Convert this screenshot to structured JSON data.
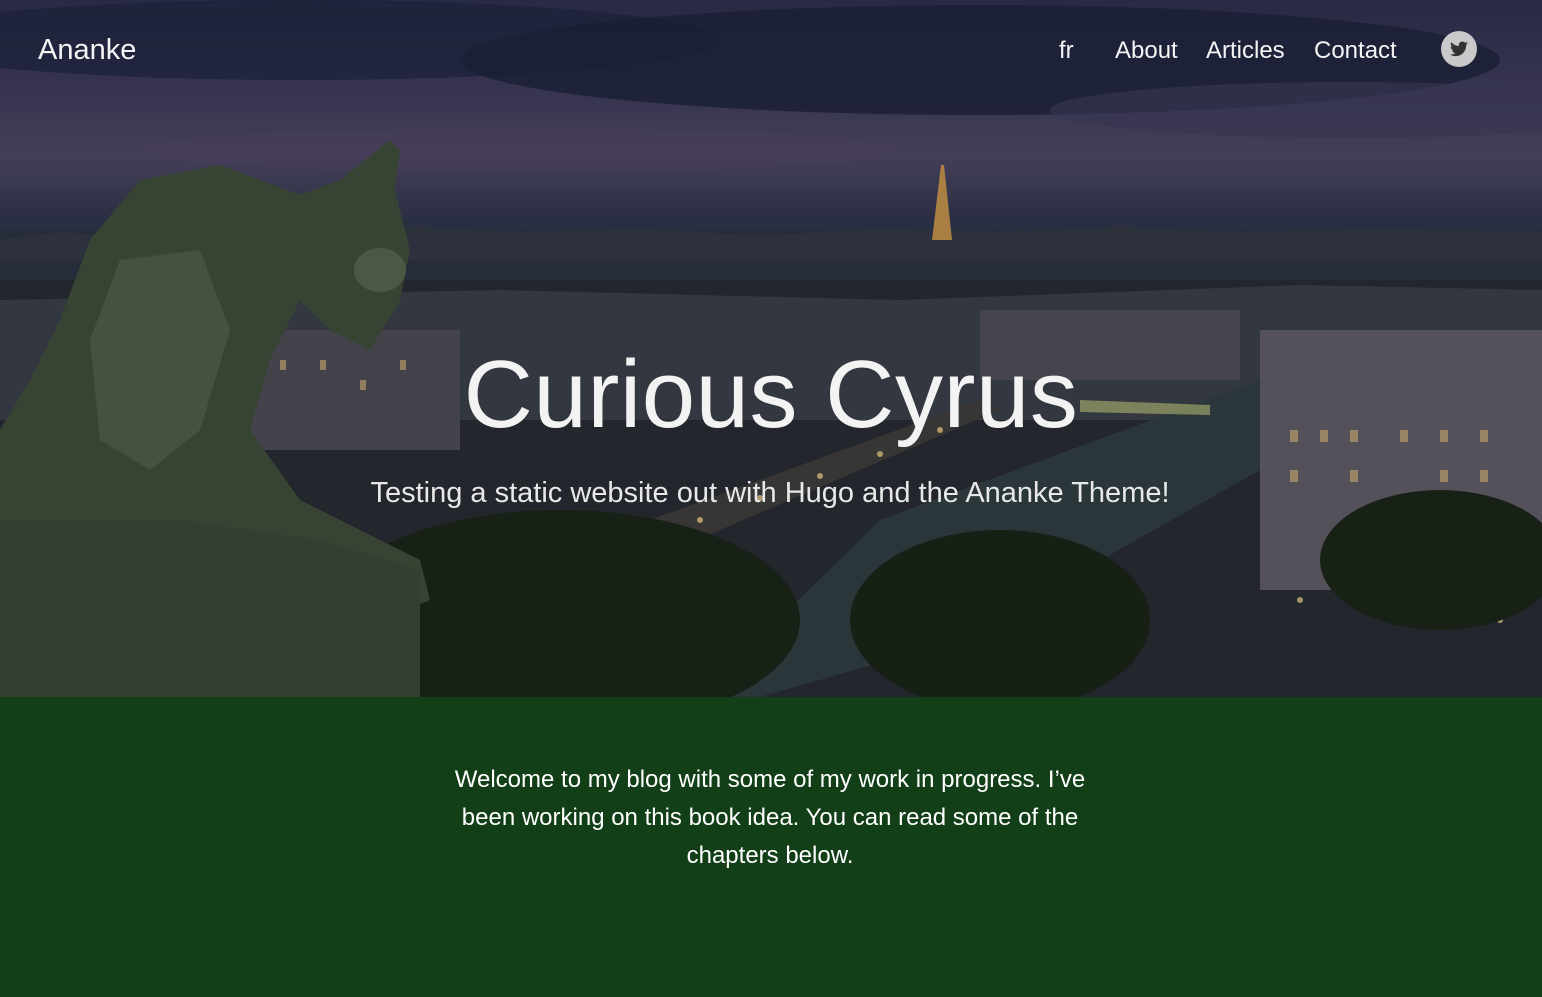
{
  "site": {
    "logo": "Ananke"
  },
  "nav": {
    "items": [
      {
        "label": "fr"
      },
      {
        "label": "About"
      },
      {
        "label": "Articles"
      },
      {
        "label": "Contact"
      }
    ],
    "social_icon": "twitter-icon"
  },
  "hero": {
    "title": "Curious Cyrus",
    "subtitle": "Testing a static website out with Hugo and the Ananke Theme!"
  },
  "main": {
    "intro": "Welcome to my blog with some of my work in progress. I’ve been working on this book idea. You can read some of the chapters below."
  },
  "colors": {
    "content_background": "#123e18",
    "text": "#ffffff",
    "twitter_badge": "#c9c9cb"
  }
}
